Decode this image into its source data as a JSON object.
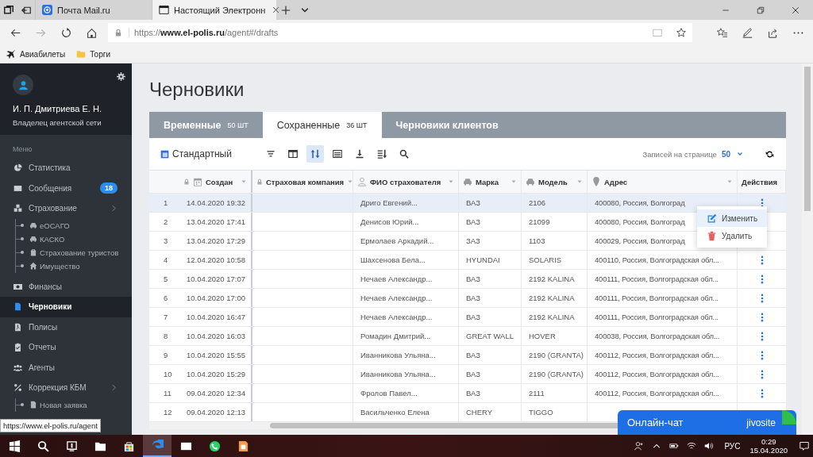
{
  "browser": {
    "tabs": [
      {
        "title": "Почта Mail.ru",
        "selected": false
      },
      {
        "title": "Настоящий Электронн",
        "selected": true
      }
    ],
    "url": "https://**www.el-polis.ru**/agent#/drafts",
    "bookmarks": [
      "Авиабилеты",
      "Торги"
    ]
  },
  "sidebar": {
    "user_name": "И. П. Дмитриева Е. Н.",
    "user_role": "Владелец агентской сети",
    "menu_heading": "Меню",
    "items": [
      {
        "label": "Статистика",
        "selected": false
      },
      {
        "label": "Сообщения",
        "badge": "18",
        "selected": false
      },
      {
        "label": "Страхование",
        "selected": false,
        "children": [
          "еОСАГО",
          "КАСКО",
          "Страхование туристов",
          "Имущество"
        ]
      },
      {
        "label": "Финансы",
        "selected": false
      },
      {
        "label": "Черновики",
        "selected": true
      },
      {
        "label": "Полисы",
        "selected": false
      },
      {
        "label": "Отчеты",
        "selected": false
      },
      {
        "label": "Агенты",
        "selected": false
      },
      {
        "label": "Коррекция КБМ",
        "selected": false,
        "children": [
          "Новая заявка"
        ]
      }
    ]
  },
  "page": {
    "title": "Черновики",
    "tabs": [
      {
        "label": "Временные",
        "count": "50 ШТ",
        "selected": false
      },
      {
        "label": "Сохраненные",
        "count": "36 ШТ",
        "selected": true
      },
      {
        "label": "Черновики клиентов",
        "selected": false
      }
    ],
    "view": "Стандартный",
    "toolbar": [
      {
        "selected": false
      },
      {
        "selected": false
      },
      {
        "selected": true
      },
      {
        "selected": false
      },
      {
        "selected": false
      },
      {
        "selected": false
      },
      {
        "selected": false
      }
    ],
    "per_page_label": "Записей на странице",
    "per_page": "50"
  },
  "table": {
    "columns": [
      "Создан",
      "Страховая компания",
      "ФИО страхователя",
      "Марка",
      "Модель",
      "Адрес",
      "Действия"
    ],
    "rows": [
      {
        "num": "1",
        "created": "14.04.2020 19:32",
        "insurer": "Дриго Евгений...",
        "brand": "ВАЗ",
        "model": "2106",
        "address": "400080, Россия, Волгоград",
        "actions": true,
        "selected": true
      },
      {
        "num": "2",
        "created": "13.04.2020 17:41",
        "insurer": "Денисов Юрий...",
        "brand": "ВАЗ",
        "model": "21099",
        "address": "400080, Россия, Волгоград",
        "selected": false
      },
      {
        "num": "3",
        "created": "13.04.2020 17:29",
        "insurer": "Ермолаев Аркадий...",
        "brand": "ЗАЗ",
        "model": "1103",
        "address": "400029, Россия, Волгоград",
        "selected": false
      },
      {
        "num": "4",
        "created": "12.04.2020 10:58",
        "insurer": "Шахсенова Бела...",
        "brand": "HYUNDAI",
        "model": "SOLARIS",
        "address": "400110, Россия, Волгоградская обл...",
        "actions": true,
        "selected": false
      },
      {
        "num": "5",
        "created": "10.04.2020 17:07",
        "insurer": "Нечаев Александр...",
        "brand": "ВАЗ",
        "model": "2192 KALINA",
        "address": "400111, Россия, Волгоградская обл...",
        "actions": true,
        "selected": false
      },
      {
        "num": "6",
        "created": "10.04.2020 17:00",
        "insurer": "Нечаев Александр...",
        "brand": "ВАЗ",
        "model": "2192 KALINA",
        "address": "400111, Россия, Волгоградская обл...",
        "actions": true,
        "selected": false
      },
      {
        "num": "7",
        "created": "10.04.2020 16:47",
        "insurer": "Нечаев Александр...",
        "brand": "ВАЗ",
        "model": "2192 KALINA",
        "address": "400111, Россия, Волгоградская обл...",
        "actions": true,
        "selected": false
      },
      {
        "num": "8",
        "created": "10.04.2020 16:03",
        "insurer": "Ромадин Дмитрий...",
        "brand": "GREAT WALL",
        "model": "HOVER",
        "address": "400038, Россия, Волгоградская обл...",
        "actions": true,
        "selected": false
      },
      {
        "num": "9",
        "created": "10.04.2020 15:55",
        "insurer": "Иванникова Ульяна...",
        "brand": "ВАЗ",
        "model": "2190 (GRANTA)",
        "address": "400112, Россия, Волгоградская обл...",
        "actions": true,
        "selected": false
      },
      {
        "num": "10",
        "created": "10.04.2020 15:29",
        "insurer": "Иванникова Ульяна...",
        "brand": "ВАЗ",
        "model": "2190 (GRANTA)",
        "address": "400112, Россия, Волгоградская обл...",
        "actions": true,
        "selected": false
      },
      {
        "num": "11",
        "created": "09.04.2020 12:34",
        "insurer": "Фролов Павел...",
        "brand": "ВАЗ",
        "model": "2111",
        "address": "400112, Россия, Волгоградская обл...",
        "actions": true,
        "selected": false
      },
      {
        "num": "12",
        "created": "09.04.2020 12:13",
        "insurer": "Васильченко Елена",
        "brand": "CHERY",
        "model": "TIGGO",
        "selected": false
      }
    ]
  },
  "context_menu": {
    "items": [
      {
        "label": "Изменить",
        "kind": "edit",
        "selected": true
      },
      {
        "label": "Удалить",
        "kind": "delete",
        "selected": false
      }
    ]
  },
  "chat": {
    "label": "Онлайн-чат",
    "brand": "jivosite"
  },
  "status_url": "https://www.el-polis.ru/agent",
  "taskbar": {
    "apps": [
      {
        "active": false
      },
      {
        "active": false
      },
      {
        "active": false
      },
      {
        "active": false
      },
      {
        "active": true
      },
      {
        "active": false
      },
      {
        "active": false
      },
      {
        "active": false
      }
    ],
    "language": "РУС",
    "time": "0:29",
    "date": "15.04.2020"
  }
}
